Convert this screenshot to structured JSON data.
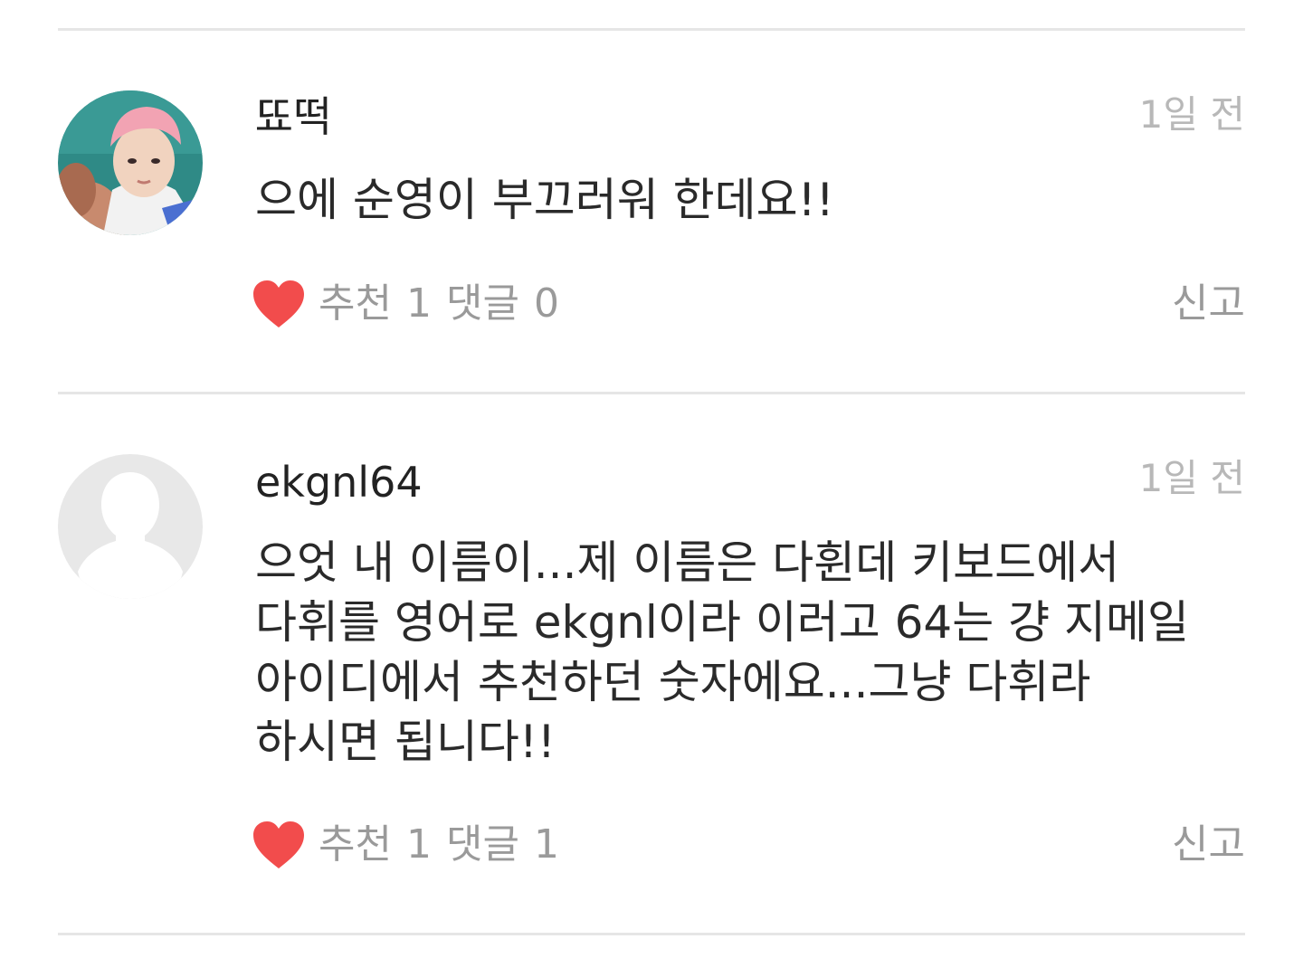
{
  "comments": [
    {
      "username": "뚀떡",
      "time": "1일 전",
      "text": "으에 순영이 부끄러워 한데요!!",
      "like_label": "추천",
      "like_count": "1",
      "reply_label": "댓글",
      "reply_count": "0",
      "report_label": "신고",
      "avatar": "profile-photo"
    },
    {
      "username": "ekgnl64",
      "time": "1일 전",
      "text": "으엇 내 이름이...제 이름은 다휜데 키보드에서 다휘를 영어로 ekgnl이라 이러고 64는 걍 지메일 아이디에서 추천하던 숫자에요...그냥 다휘라 하시면 됩니다!!",
      "like_label": "추천",
      "like_count": "1",
      "reply_label": "댓글",
      "reply_count": "1",
      "report_label": "신고",
      "avatar": "default-avatar"
    }
  ],
  "colors": {
    "heart": "#f24c4c",
    "divider": "#e6e6e6",
    "muted_text": "#9a9a9a",
    "time_text": "#b8b8b8"
  }
}
